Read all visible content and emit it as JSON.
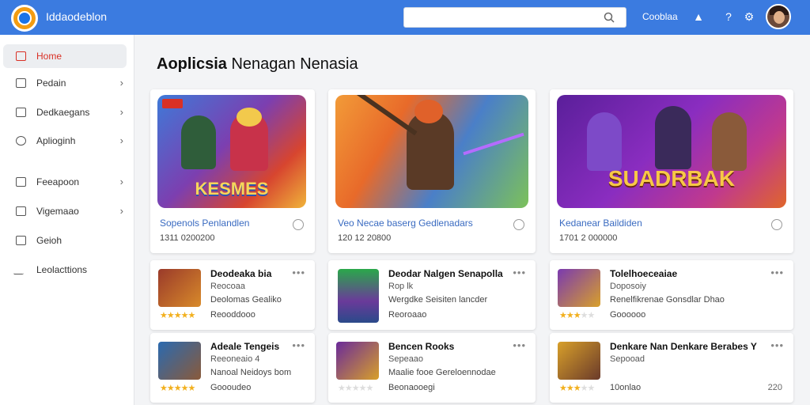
{
  "app": {
    "title": "Iddaodeblon"
  },
  "header": {
    "link": "Cooblaa"
  },
  "sidebar": {
    "items": [
      {
        "label": "Home",
        "active": true
      },
      {
        "label": "Pedain"
      },
      {
        "label": "Dedkaegans"
      },
      {
        "label": "Aplioginh"
      },
      {
        "label": "Feeapoon"
      },
      {
        "label": "Vigemaao"
      },
      {
        "label": "Geioh"
      },
      {
        "label": "Leolacttions"
      }
    ]
  },
  "main": {
    "title_bold": "Aoplicsia",
    "title_rest": "Nenagan Nenasia"
  },
  "featured": [
    {
      "title": "Sopenols Penlandlen",
      "meta": "1311 0200200",
      "banner": "KESMES"
    },
    {
      "title": "Veo Necae baserg Gedlenadars",
      "meta": "120  12 20800",
      "banner": ""
    },
    {
      "title": "Kedanear Baildiden",
      "meta": "1701  2 000000",
      "banner": "SUADRBAK"
    }
  ],
  "cards": [
    {
      "title": "Deodeaka bia",
      "sub": "Reocoaa",
      "desc": "Deolomas Gealiko",
      "foot": "Reooddooo",
      "rating": 5,
      "extra": ""
    },
    {
      "title": "Deodar Nalgen Senapolla",
      "sub": "Rop lk",
      "desc": "Wergdke Seisiten lancder",
      "foot": "Reoroaao",
      "rating": 0,
      "extra": ""
    },
    {
      "title": "Tolelhoeceaiae",
      "sub": "Doposoiy",
      "desc": "Renelfikrenae Gonsdlar Dhao",
      "foot": "Goooooo",
      "rating": 3,
      "extra": ""
    },
    {
      "title": "Adeale Tengeis",
      "sub": "Reeoneaio 4",
      "desc": "Nanoal Neidoys bom",
      "foot": "Goooudeo",
      "rating": 5,
      "extra": ""
    },
    {
      "title": "Bencen Rooks",
      "sub": "Sepeaao",
      "desc": "Maalie fooe Gereloennodae",
      "foot": "Beonaooegi",
      "rating": 0,
      "extra": ""
    },
    {
      "title": "Denkare Nan Denkare Berabes Y",
      "sub": "Sepooad",
      "desc": "",
      "foot": "10onlao",
      "rating": 3,
      "extra": "220"
    }
  ],
  "colors": {
    "header": "#3b7be0",
    "active": "#d93025",
    "accent_link": "#3a6bc1"
  }
}
